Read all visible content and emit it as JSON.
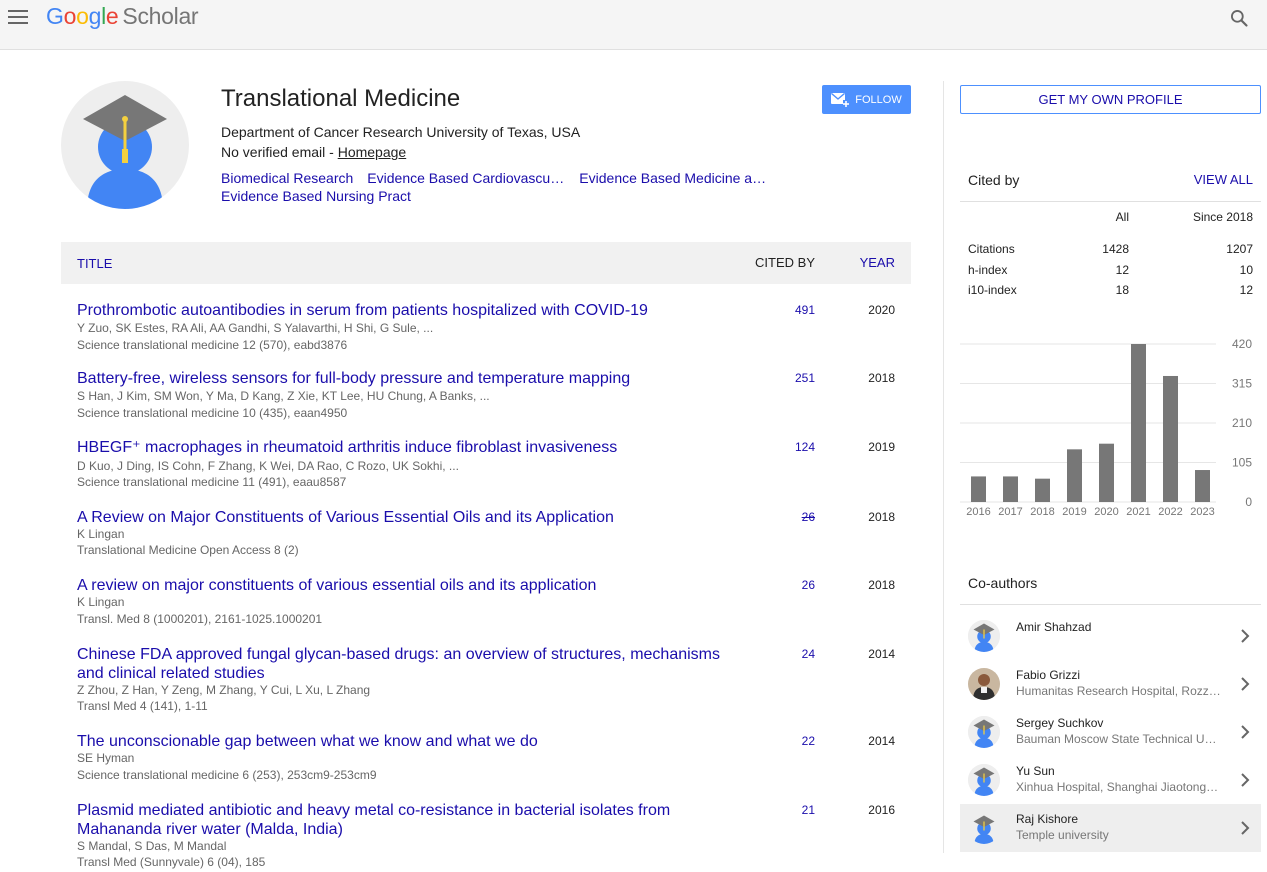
{
  "header": {
    "logo_letters": [
      "G",
      "o",
      "o",
      "g",
      "l",
      "e"
    ],
    "logo_product": "Scholar",
    "icons": [
      "menu-icon",
      "search-icon"
    ]
  },
  "profile": {
    "name": "Translational Medicine",
    "affiliation": "Department of Cancer Research University of Texas, USA",
    "email_text": "No verified email - ",
    "homepage_label": "Homepage",
    "follow_label": "FOLLOW",
    "interests": [
      "Biomedical Research",
      "Evidence Based Cardiovascular Medicine",
      "Evidence Based Medicine and Practice",
      "Evidence Based Nursing Pract"
    ]
  },
  "table": {
    "col_title": "TITLE",
    "col_cited": "CITED BY",
    "col_year": "YEAR",
    "rows": [
      {
        "title": "Prothrombotic autoantibodies in serum from patients hospitalized with COVID-19",
        "authors": "Y Zuo, SK Estes, RA Ali, AA Gandhi, S Yalavarthi, H Shi, G Sule, ...",
        "venue": "Science translational medicine 12 (570), eabd3876",
        "cited": "491",
        "year": "2020"
      },
      {
        "title": "Battery-free, wireless sensors for full-body pressure and temperature mapping",
        "authors": "S Han, J Kim, SM Won, Y Ma, D Kang, Z Xie, KT Lee, HU Chung, A Banks, ...",
        "venue": "Science translational medicine 10 (435), eaan4950",
        "cited": "251",
        "year": "2018"
      },
      {
        "title": "HBEGF⁺ macrophages in rheumatoid arthritis induce fibroblast invasiveness",
        "authors": "D Kuo, J Ding, IS Cohn, F Zhang, K Wei, DA Rao, C Rozo, UK Sokhi, ...",
        "venue": "Science translational medicine 11 (491), eaau8587",
        "cited": "124",
        "year": "2019"
      },
      {
        "title": "A Review on Major Constituents of Various Essential Oils and its Application",
        "authors": "K Lingan",
        "venue": "Translational Medicine Open Access 8 (2)",
        "cited": "26",
        "year": "2018",
        "strike": true
      },
      {
        "title": "A review on major constituents of various essential oils and its application",
        "authors": "K Lingan",
        "venue": "Transl. Med 8 (1000201), 2161-1025.1000201",
        "cited": "26",
        "year": "2018"
      },
      {
        "title": "Chinese FDA approved fungal glycan-based drugs: an overview of structures, mechanisms and clinical related studies",
        "authors": "Z Zhou, Z Han, Y Zeng, M Zhang, Y Cui, L Xu, L Zhang",
        "venue": "Transl Med 4 (141), 1-11",
        "cited": "24",
        "year": "2014"
      },
      {
        "title": "The unconscionable gap between what we know and what we do",
        "authors": "SE Hyman",
        "venue": "Science translational medicine 6 (253), 253cm9-253cm9",
        "cited": "22",
        "year": "2014"
      },
      {
        "title": "Plasmid mediated antibiotic and heavy metal co-resistance in bacterial isolates from Mahananda river water (Malda, India)",
        "authors": "S Mandal, S Das, M Mandal",
        "venue": "Transl Med (Sunnyvale) 6 (04), 185",
        "cited": "21",
        "year": "2016"
      }
    ]
  },
  "sidebar": {
    "own_profile_label": "GET MY OWN PROFILE",
    "cited_by_title": "Cited by",
    "view_all_label": "VIEW ALL",
    "stats_headers": [
      "All",
      "Since 2018"
    ],
    "stats": [
      {
        "label": "Citations",
        "all": "1428",
        "since": "1207"
      },
      {
        "label": "h-index",
        "all": "12",
        "since": "10"
      },
      {
        "label": "i10-index",
        "all": "18",
        "since": "12"
      }
    ],
    "coauthors_title": "Co-authors",
    "coauthors": [
      {
        "name": "Amir Shahzad",
        "affiliation": "",
        "avatar": "default-avatar-icon"
      },
      {
        "name": "Fabio Grizzi",
        "affiliation": "Humanitas Research Hospital, Rozzano, Milan, Italy",
        "avatar": "photo"
      },
      {
        "name": "Sergey Suchkov",
        "affiliation": "Bauman Moscow State Technical University",
        "avatar": "default-avatar-icon"
      },
      {
        "name": "Yu Sun",
        "affiliation": "Xinhua Hospital, Shanghai Jiaotong University",
        "avatar": "default-avatar-icon"
      },
      {
        "name": "Raj Kishore",
        "affiliation": "Temple university",
        "avatar": "default-avatar-icon",
        "highlighted": true
      }
    ]
  },
  "chart_data": {
    "type": "bar",
    "categories": [
      "2016",
      "2017",
      "2018",
      "2019",
      "2020",
      "2021",
      "2022",
      "2023"
    ],
    "values": [
      68,
      68,
      62,
      140,
      155,
      420,
      335,
      85
    ],
    "ylim": [
      0,
      420
    ],
    "yticks": [
      "0",
      "105",
      "210",
      "315",
      "420"
    ],
    "grid": true,
    "bar_color": "#777777"
  },
  "colors": {
    "link": "#1a0dab",
    "button": "#4d90fe",
    "avatar_blue": "#4285f4",
    "cap": "#777777",
    "tassel": "#f4d03f"
  }
}
